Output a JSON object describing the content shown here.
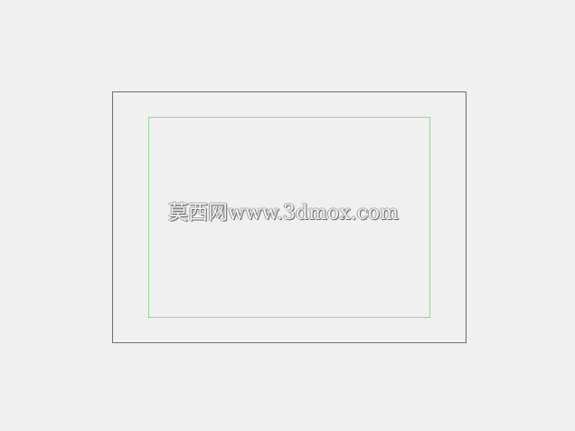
{
  "watermark": {
    "text": "莫西网www.3dmox.com"
  },
  "colors": {
    "background": "#f0f0f0",
    "outer_frame": "#6e6e6e",
    "inner_frame": "#8edc8e"
  }
}
